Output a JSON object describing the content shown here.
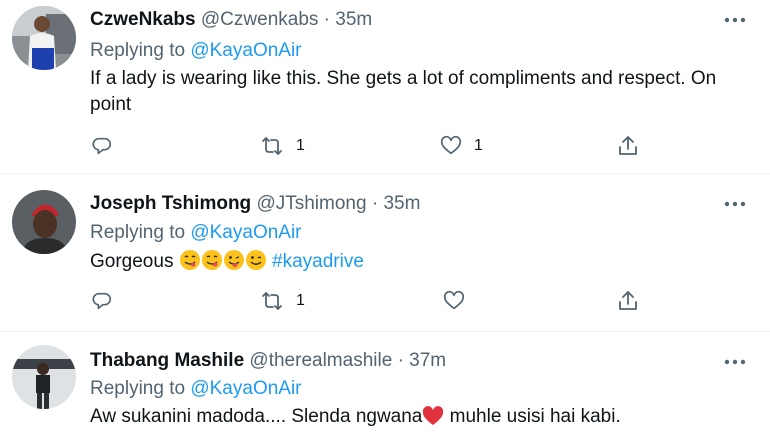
{
  "tweets": [
    {
      "name": "CzweNkabs",
      "handle": "@Czwenkabs",
      "dot": "·",
      "time": "35m",
      "replying_prefix": "Replying to",
      "replying_to": "@KayaOnAir",
      "text_line1": "If a lady is wearing like this. She gets a lot of compliments and respect. On",
      "text_line2": "point",
      "reply_count": "",
      "retweet_count": "1",
      "like_count": "1"
    },
    {
      "name": "Joseph Tshimong",
      "handle": "@JTshimong",
      "dot": "·",
      "time": "35m",
      "replying_prefix": "Replying to",
      "replying_to": "@KayaOnAir",
      "text_word": "Gorgeous",
      "emojis": [
        "face-savoring-food-emoji",
        "face-savoring-food-emoji",
        "winking-face-tongue-emoji",
        "winking-face-emoji"
      ],
      "hashtag": "#kayadrive",
      "reply_count": "",
      "retweet_count": "1",
      "like_count": ""
    },
    {
      "name": "Thabang Mashile",
      "handle": "@therealmashile",
      "dot": "·",
      "time": "37m",
      "replying_prefix": "Replying to",
      "replying_to": "@KayaOnAir",
      "text_before": "Aw sukanini madoda.... Slenda ngwana",
      "emoji": "red-heart-emoji",
      "text_after": " muhle usisi hai kabi."
    }
  ],
  "icons": {
    "reply": "reply-icon",
    "retweet": "retweet-icon",
    "like": "like-icon",
    "share": "share-icon",
    "more": "more-icon"
  },
  "colors": {
    "text": "#0f1419",
    "secondary": "#536471",
    "accent": "#1d9bf0",
    "divider": "#eff3f4"
  }
}
